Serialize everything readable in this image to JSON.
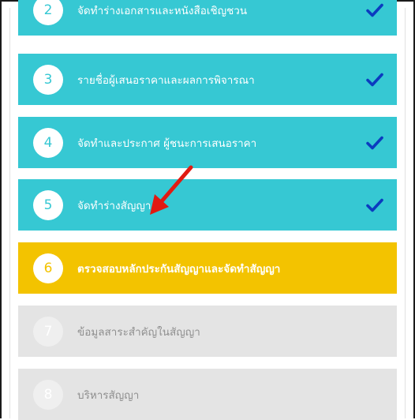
{
  "steps": [
    {
      "number": "2",
      "label": "จัดทำร่างเอกสารและหนังสือเชิญชวน",
      "status": "done"
    },
    {
      "number": "3",
      "label": "รายชื่อผู้เสนอราคาและผลการพิจารณา",
      "status": "done"
    },
    {
      "number": "4",
      "label": "จัดทำและประกาศ ผู้ชนะการเสนอราคา",
      "status": "done"
    },
    {
      "number": "5",
      "label": "จัดทำร่างสัญญา",
      "status": "done"
    },
    {
      "number": "6",
      "label": "ตรวจสอบหลักประกันสัญญาและจัดทำสัญญา",
      "status": "current"
    },
    {
      "number": "7",
      "label": "ข้อมูลสาระสำคัญในสัญญา",
      "status": "pending"
    },
    {
      "number": "8",
      "label": "บริหารสัญญา",
      "status": "pending"
    }
  ],
  "colors": {
    "done": "#36c8d3",
    "current": "#f3c300",
    "pending": "#e4e4e4",
    "check": "#0b3bbf",
    "annotation_arrow": "#e11a12"
  },
  "icons": {
    "completed": "checkmark-icon",
    "annotation": "red-arrow-annotation"
  }
}
